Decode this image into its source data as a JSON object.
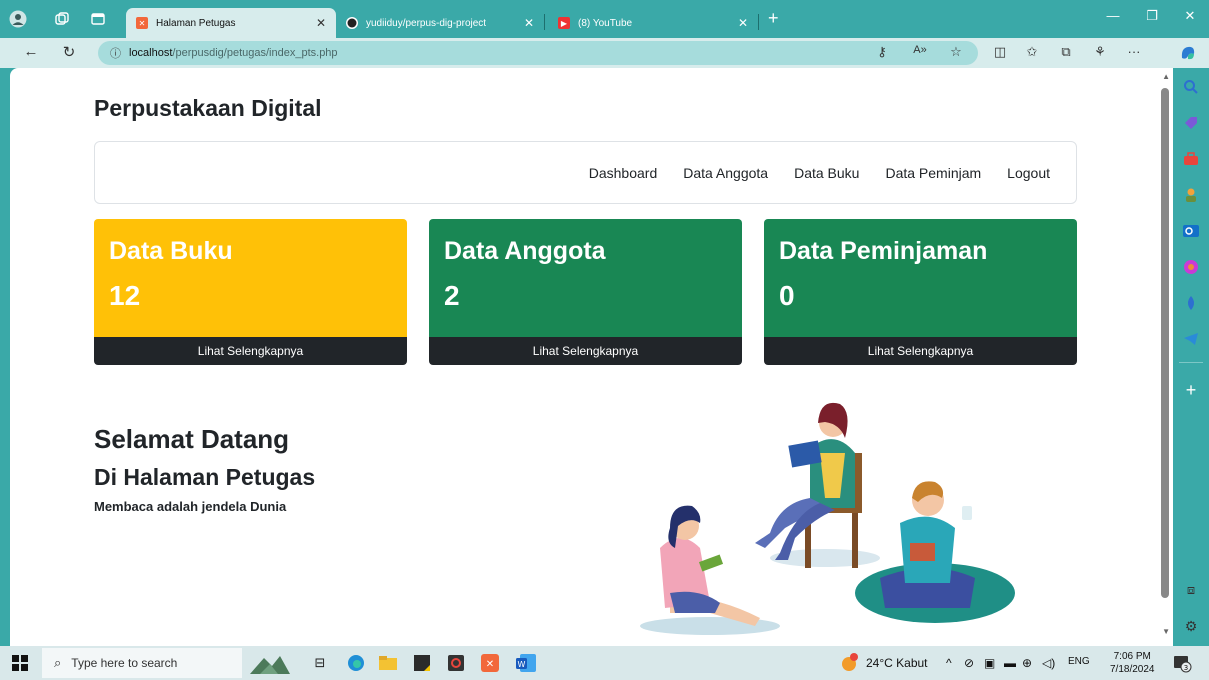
{
  "browser": {
    "tabs": [
      {
        "title": "Halaman Petugas",
        "active": true
      },
      {
        "title": "yudiiduy/perpus-dig-project",
        "active": false
      },
      {
        "title": "(8) YouTube",
        "active": false
      }
    ],
    "url_host": "localhost",
    "url_path": "/perpusdig/petugas/index_pts.php"
  },
  "site": {
    "title": "Perpustakaan Digital"
  },
  "nav": {
    "items": [
      "Dashboard",
      "Data Anggota",
      "Data Buku",
      "Data Peminjam",
      "Logout"
    ]
  },
  "cards": [
    {
      "label": "Data Buku",
      "count": "12",
      "link": "Lihat Selengkapnya",
      "color": "#ffc107"
    },
    {
      "label": "Data Anggota",
      "count": "2",
      "link": "Lihat Selengkapnya",
      "color": "#198754"
    },
    {
      "label": "Data Peminjaman",
      "count": "0",
      "link": "Lihat Selengkapnya",
      "color": "#198754"
    }
  ],
  "welcome": {
    "heading": "Selamat Datang",
    "subheading": "Di Halaman Petugas",
    "tagline": "Membaca adalah jendela Dunia"
  },
  "taskbar": {
    "search_placeholder": "Type here to search",
    "weather": "24°C  Kabut",
    "lang": "ENG",
    "time": "7:06 PM",
    "date": "7/18/2024",
    "notifications": "3"
  },
  "colors": {
    "browser_frame": "#3aa9a8",
    "warning": "#ffc107",
    "success": "#198754",
    "dark": "#212529"
  }
}
